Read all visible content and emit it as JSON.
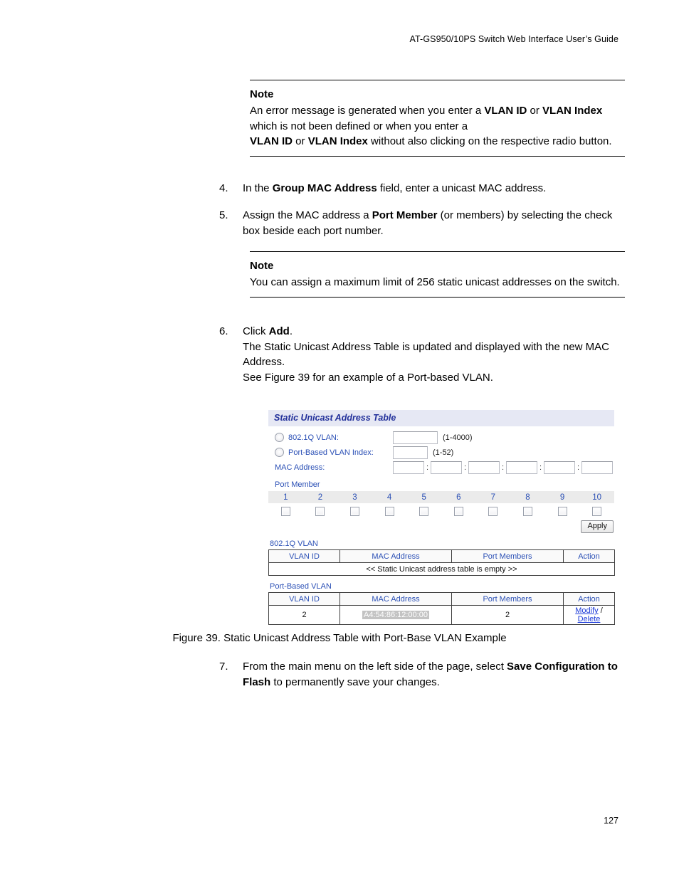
{
  "header": {
    "running_head": "AT-GS950/10PS Switch Web Interface User’s Guide"
  },
  "note1": {
    "title": "Note",
    "line1_a": "An error message is generated when you enter a ",
    "line1_b": "VLAN ID",
    "line1_c": " or ",
    "line1_d": "VLAN Index",
    "line1_e": " which is not been defined or when you enter a",
    "line2_a": "VLAN ID",
    "line2_b": " or ",
    "line2_c": "VLAN Index",
    "line2_d": " without also clicking on the respective radio button."
  },
  "step4": {
    "num": "4.",
    "a": "In the ",
    "b": "Group MAC Address",
    "c": " field, enter a unicast MAC address."
  },
  "step5": {
    "num": "5.",
    "a": "Assign the MAC address a ",
    "b": "Port Member",
    "c": " (or members) by selecting the check box beside each port number."
  },
  "note2": {
    "title": "Note",
    "text": "You can assign a maximum limit of 256 static unicast addresses on the switch."
  },
  "step6": {
    "num": "6.",
    "a": "Click ",
    "b": "Add",
    "c": ".",
    "line2": "The Static Unicast Address Table is updated and displayed with the new MAC Address.",
    "line3": "See Figure 39 for an example of a Port-based VLAN."
  },
  "step7": {
    "num": "7.",
    "a": "From the main menu on the left side of the page, select ",
    "b": "Save Configuration to Flash",
    "c": " to permanently save your changes."
  },
  "caption": "Figure 39. Static Unicast Address Table with Port-Base VLAN Example",
  "page_number": "127",
  "figure": {
    "panel_title": "Static Unicast Address Table",
    "fields": {
      "vlan_8021q_label": "802.1Q VLAN:",
      "vlan_8021q_value": "",
      "vlan_8021q_hint": "(1-4000)",
      "portbased_label": "Port-Based VLAN Index:",
      "portbased_value": "",
      "portbased_hint": "(1-52)",
      "mac_label": "MAC Address:",
      "mac_octets": [
        "",
        "",
        "",
        "",
        "",
        ""
      ],
      "mac_separator": ":"
    },
    "port_member": {
      "label": "Port Member",
      "ports": [
        "1",
        "2",
        "3",
        "4",
        "5",
        "6",
        "7",
        "8",
        "9",
        "10"
      ],
      "checked": [
        false,
        false,
        false,
        false,
        false,
        false,
        false,
        false,
        false,
        false
      ]
    },
    "apply_label": "Apply",
    "table_8021q": {
      "label": "802.1Q VLAN",
      "columns": [
        "VLAN ID",
        "MAC Address",
        "Port Members",
        "Action"
      ],
      "empty_message": "<< Static Unicast address table is empty >>",
      "rows": []
    },
    "table_portbased": {
      "label": "Port-Based VLAN",
      "columns": [
        "VLAN ID",
        "MAC Address",
        "Port Members",
        "Action"
      ],
      "rows": [
        {
          "vlan_id": "2",
          "mac_address": "A4:54:86:12:00:00",
          "port_members": "2",
          "action_modify": "Modify",
          "action_sep": " / ",
          "action_delete": "Delete"
        }
      ]
    }
  },
  "colors": {
    "panel_title_bg": "#e6e8f4",
    "panel_title_fg": "#22309a",
    "field_label": "#2a4fb5",
    "link": "#1a39d8",
    "selection_bg": "#c3c3c3"
  }
}
